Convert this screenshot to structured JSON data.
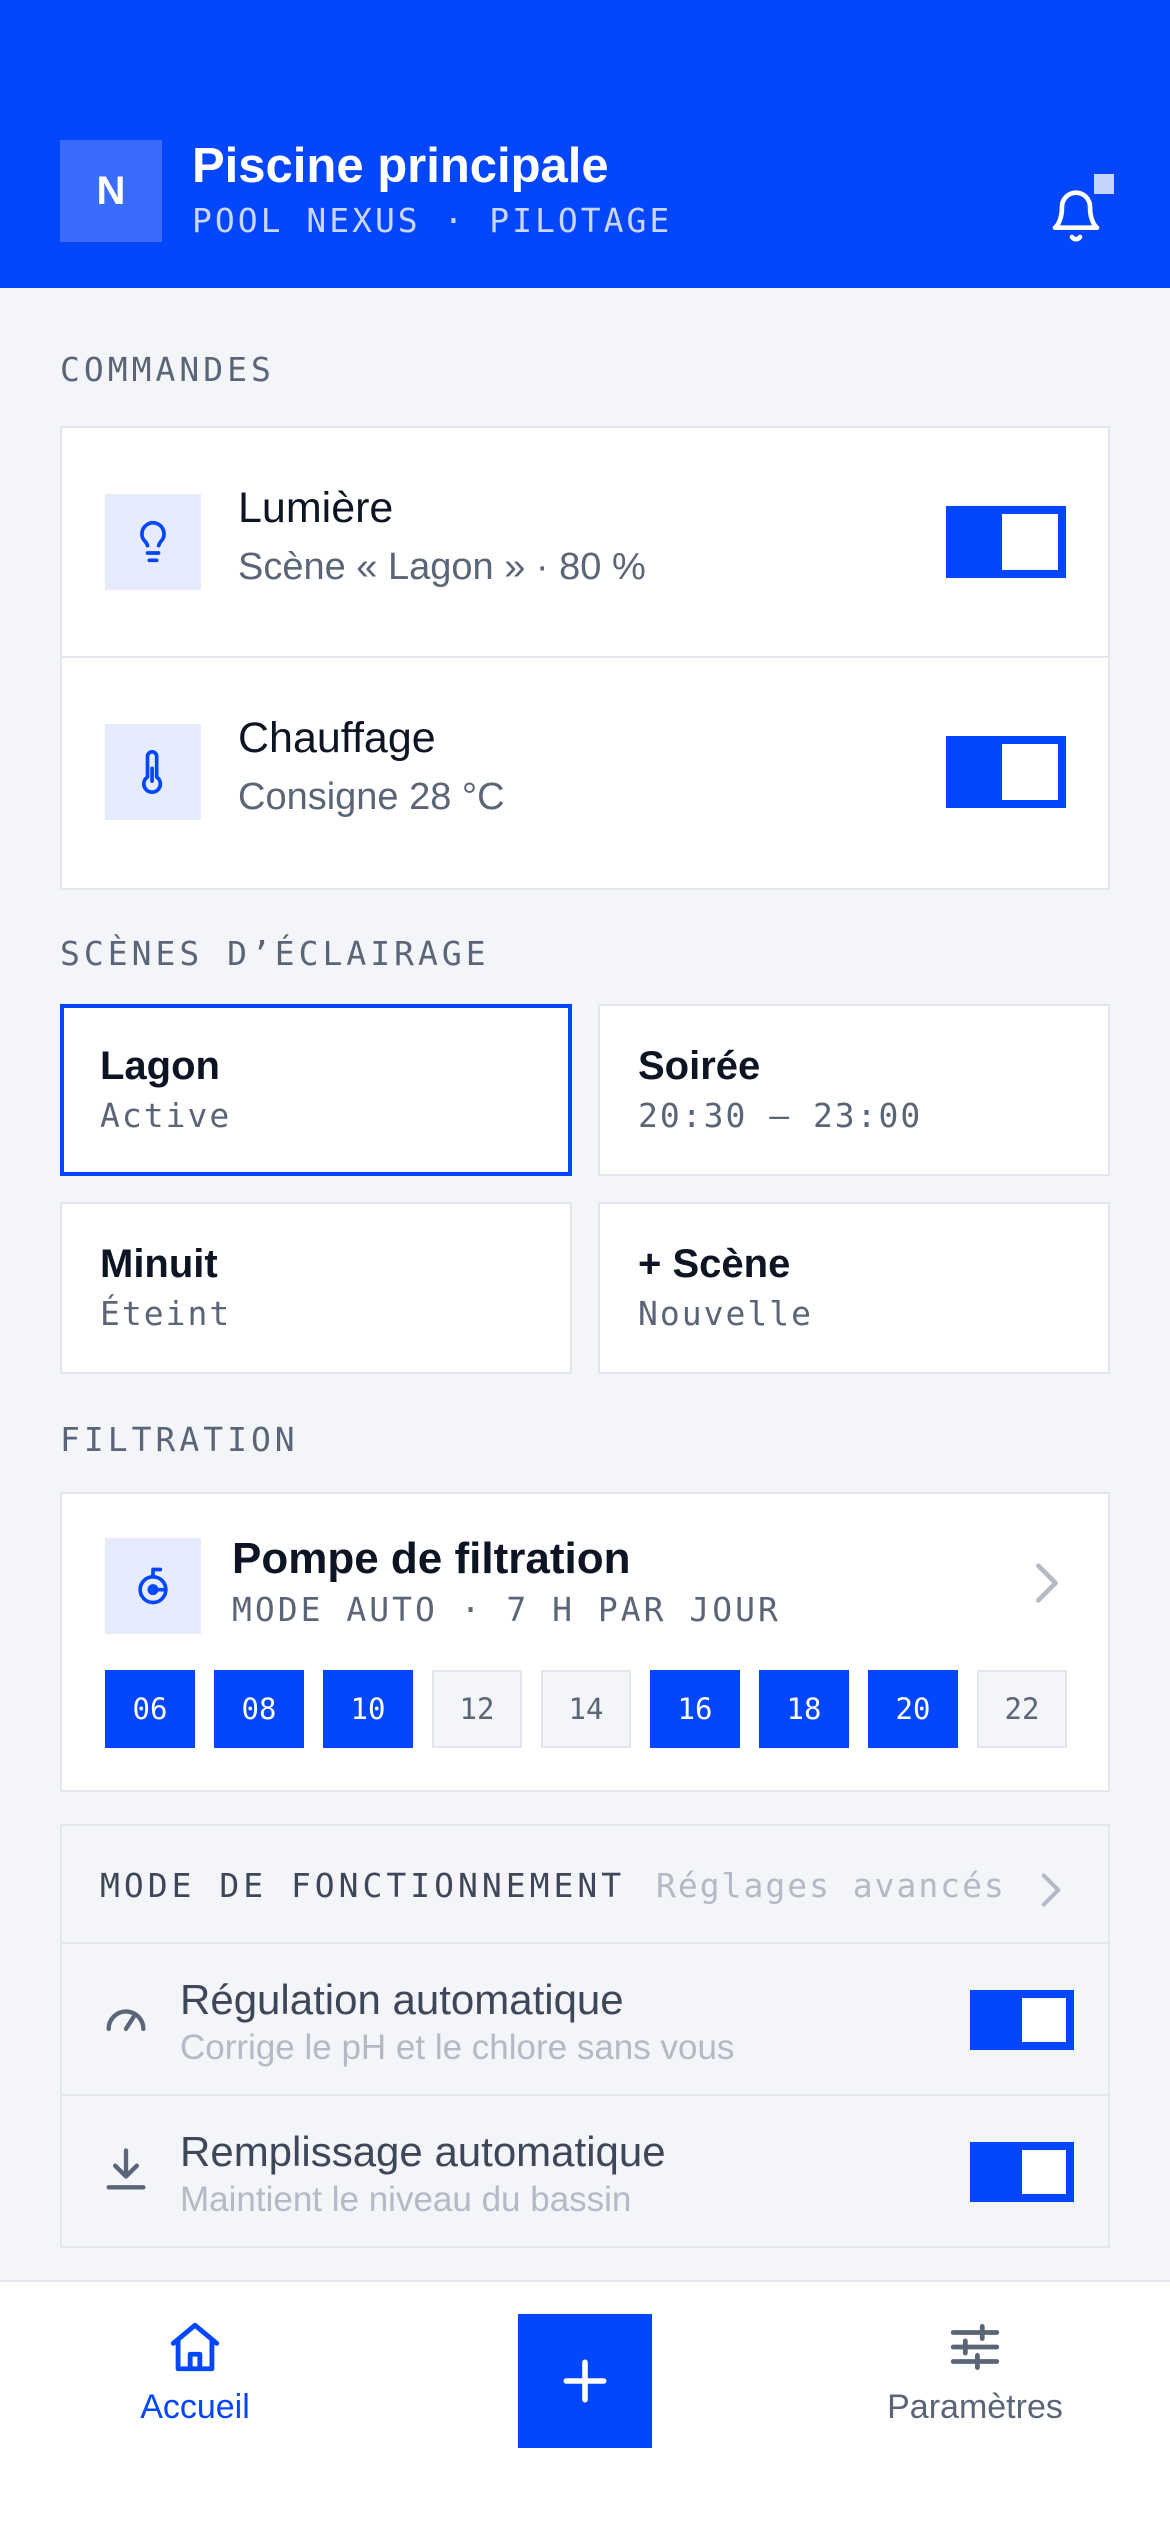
{
  "header": {
    "avatar_initial": "N",
    "title": "Piscine principale",
    "subtitle": "POOL NEXUS · PILOTAGE"
  },
  "sections": {
    "commandes": "COMMANDES",
    "scenes": "SCÈNES D’ÉCLAIRAGE",
    "filtration": "FILTRATION"
  },
  "commands": [
    {
      "title": "Lumière",
      "subtitle": "Scène « Lagon » · 80 %",
      "icon": "bulb-icon",
      "on": true
    },
    {
      "title": "Chauffage",
      "subtitle": "Consigne 28 °C",
      "icon": "thermometer-icon",
      "on": true
    }
  ],
  "scenes": [
    {
      "title": "Lagon",
      "subtitle": "Active",
      "selected": true
    },
    {
      "title": "Soirée",
      "subtitle": "20:30 — 23:00",
      "selected": false
    },
    {
      "title": "Minuit",
      "subtitle": "Éteint",
      "selected": false
    },
    {
      "title": "+ Scène",
      "subtitle": "Nouvelle",
      "selected": false
    }
  ],
  "filtration": {
    "title": "Pompe de filtration",
    "subtitle": "MODE AUTO · 7 H PAR JOUR",
    "hours": [
      {
        "label": "06",
        "on": true
      },
      {
        "label": "08",
        "on": true
      },
      {
        "label": "10",
        "on": true
      },
      {
        "label": "12",
        "on": false
      },
      {
        "label": "14",
        "on": false
      },
      {
        "label": "16",
        "on": true
      },
      {
        "label": "18",
        "on": true
      },
      {
        "label": "20",
        "on": true
      },
      {
        "label": "22",
        "on": false
      }
    ]
  },
  "mode": {
    "title": "MODE DE FONCTIONNEMENT",
    "link": "Réglages avancés",
    "rows": [
      {
        "title": "Régulation automatique",
        "subtitle": "Corrige le pH et le chlore sans vous",
        "icon": "gauge-icon",
        "on": true
      },
      {
        "title": "Remplissage automatique",
        "subtitle": "Maintient le niveau du bassin",
        "icon": "download-icon",
        "on": true
      }
    ]
  },
  "nav": {
    "home": "Accueil",
    "settings": "Paramètres"
  },
  "colors": {
    "accent": "#0446fb",
    "background": "#f3f5f9",
    "muted": "#5b6578"
  }
}
